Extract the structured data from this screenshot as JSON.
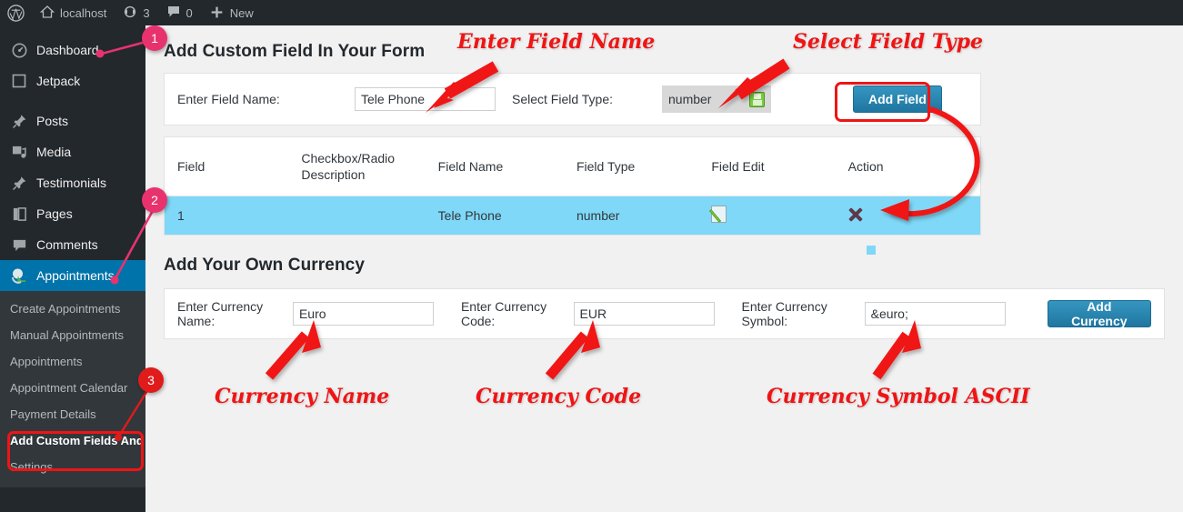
{
  "adminbar": {
    "logo_icon": "wordpress-logo-icon",
    "site_name": "localhost",
    "home_icon": "home-icon",
    "updates_icon": "updates-icon",
    "updates_count": "3",
    "comments_icon": "comments-icon",
    "comments_count": "0",
    "new_icon": "plus-icon",
    "new_label": "New"
  },
  "sidebar": {
    "items": [
      {
        "label": "Dashboard",
        "icon": "dashboard-icon",
        "current": false
      },
      {
        "label": "Jetpack",
        "icon": "jetpack-icon",
        "current": false
      },
      {
        "label": "Posts",
        "icon": "pin-icon",
        "current": false
      },
      {
        "label": "Media",
        "icon": "media-icon",
        "current": false
      },
      {
        "label": "Testimonials",
        "icon": "pin-icon",
        "current": false
      },
      {
        "label": "Pages",
        "icon": "pages-icon",
        "current": false
      },
      {
        "label": "Comments",
        "icon": "comment-icon",
        "current": false
      },
      {
        "label": "Appointments",
        "icon": "appointments-icon",
        "current": true
      }
    ],
    "submenu": [
      {
        "label": "Create Appointments",
        "current": false
      },
      {
        "label": "Manual Appointments",
        "current": false
      },
      {
        "label": "Appointments",
        "current": false
      },
      {
        "label": "Appointment Calendar",
        "current": false
      },
      {
        "label": "Payment Details",
        "current": false
      },
      {
        "label": "Add Custom Fields And Currency",
        "current": true
      },
      {
        "label": "Settings",
        "current": false
      }
    ]
  },
  "custom_field_section": {
    "title": "Add Custom Field In Your Form",
    "field_name_label": "Enter Field Name:",
    "field_name_value": "Tele Phone",
    "field_name_placeholder": "",
    "field_type_label": "Select Field Type:",
    "field_type_value": "number",
    "field_type_icon": "green-save-icon",
    "add_field_label": "Add Field"
  },
  "fields_table": {
    "headers": [
      "Field",
      "Checkbox/Radio Description",
      "Field Name",
      "Field Type",
      "Field Edit",
      "Action"
    ],
    "header_desc_line1": "Checkbox/Radio",
    "header_desc_line2": "Description",
    "rows": [
      {
        "field": "1",
        "description": "",
        "field_name": "Tele Phone",
        "field_type": "number",
        "edit_icon": "edit-pencil-icon",
        "action_icon": "delete-x-icon"
      }
    ]
  },
  "currency_section": {
    "title": "Add Your Own Currency",
    "name_label": "Enter Currency Name:",
    "name_value": "Euro",
    "code_label": "Enter Currency Code:",
    "code_value": "EUR",
    "symbol_label": "Enter Currency Symbol:",
    "symbol_value": "&euro;",
    "add_currency_label": "Add Currency"
  },
  "annotations": {
    "enter_field_name": "Enter Field Name",
    "select_field_type": "Select Field Type",
    "currency_name": "Currency Name",
    "currency_code": "Currency Code",
    "currency_symbol_ascii": "Currency Symbol ASCII",
    "marker_1": "1",
    "marker_2": "2",
    "marker_3": "3",
    "colors": {
      "arrow_red": "#f01414",
      "marker_pink": "#e8326e",
      "marker_red": "#e01b1b",
      "highlight_row": "#7fd8f7",
      "accent_blue": "#0073aa"
    }
  }
}
